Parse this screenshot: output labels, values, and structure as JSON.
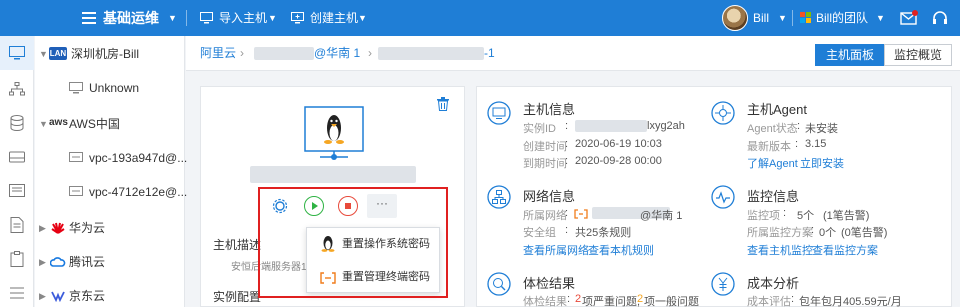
{
  "topbar": {
    "title": "基础运维",
    "import_host": "导入主机",
    "create_host": "创建主机",
    "user": "Bill",
    "team": "Bill的团队"
  },
  "tree": {
    "items": [
      {
        "label": "深圳机房-Bill",
        "badge": "LAN"
      },
      {
        "label": "Unknown"
      },
      {
        "label": "AWS中国",
        "badge": "aws"
      },
      {
        "label": "vpc-193a947d@..."
      },
      {
        "label": "vpc-4712e12e@..."
      },
      {
        "label": "华为云"
      },
      {
        "label": "腾讯云"
      },
      {
        "label": "京东云"
      }
    ]
  },
  "breadcrumb": {
    "item1": "阿里云",
    "item2_suffix": "@华南 1",
    "item3_suffix": "-1"
  },
  "tabs": {
    "host_panel": "主机面板",
    "monitor_overview": "监控概览"
  },
  "host_card": {
    "desc_label": "主机描述",
    "desc_value": "安恒后端服务器1",
    "config_label": "实例配置"
  },
  "menu": {
    "reset_os_password": "重置操作系统密码",
    "reset_mgmt_password": "重置管理终端密码"
  },
  "info": {
    "host_info": {
      "title": "主机信息",
      "instance_id_label": "实例ID",
      "instance_id_suffix": "lxyg2ah",
      "created_label": "创建时间",
      "created_value": "2020-06-19 10:03",
      "expire_label": "到期时间",
      "expire_value": "2020-09-28 00:00"
    },
    "agent": {
      "title": "主机Agent",
      "status_label": "Agent状态",
      "status_value": "未安装",
      "version_label": "最新版本",
      "version_value": "3.15",
      "learn_link": "了解Agent",
      "install_link": "立即安装"
    },
    "network": {
      "title": "网络信息",
      "net_label": "所属网络",
      "net_suffix": "@华南 1",
      "sg_label": "安全组",
      "sg_value": "共25条规则",
      "link1": "查看所属网络",
      "link2": "查看本机规则"
    },
    "monitor": {
      "title": "监控信息",
      "items_label": "监控项",
      "items_value": "5个",
      "items_note": "(1笔告警)",
      "plan_label": "所属监控方案",
      "plan_value": "0个",
      "plan_note": "(0笔告警)",
      "link1": "查看主机监控",
      "link2": "查看监控方案"
    },
    "health": {
      "title": "体检结果",
      "result_label": "体检结果",
      "severe_count": "2",
      "severe_text": "项严重问题,",
      "normal_count": "2",
      "normal_text": "项一般问题"
    },
    "cost": {
      "title": "成本分析",
      "eval_label": "成本评估",
      "eval_value": "包年包月405.59元/月"
    }
  },
  "colors": {
    "brand_blue": "#1f7ed6",
    "danger_red": "#e02020",
    "run_green": "#2fb344",
    "stop_red": "#e84a3b"
  }
}
